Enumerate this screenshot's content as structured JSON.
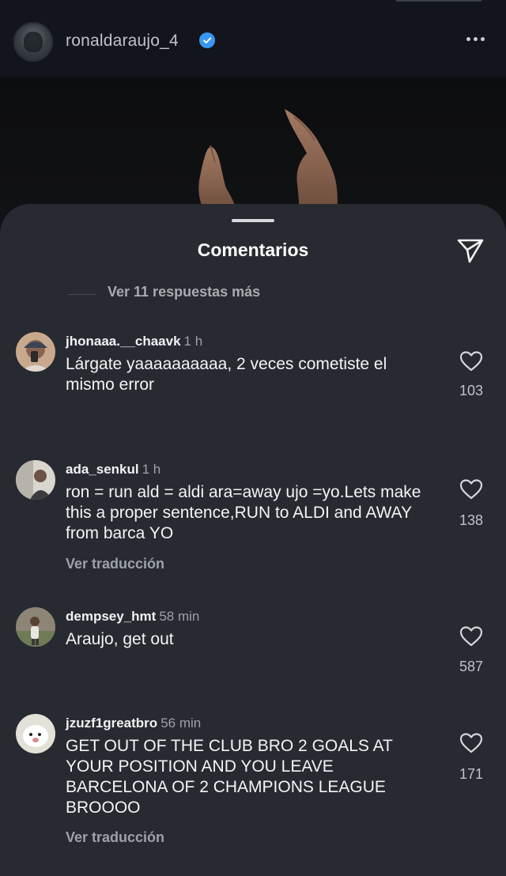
{
  "post": {
    "username": "ronaldaraujo_4"
  },
  "sheet": {
    "title": "Comentarios",
    "view_replies": "Ver 11 respuestas más"
  },
  "comments": [
    {
      "user": "jhonaaa.__chaavk",
      "time": "1 h",
      "text": "Lárgate yaaaaaaaaaa, 2 veces cometiste el mismo error",
      "likes": "103",
      "translate": ""
    },
    {
      "user": "ada_senkul",
      "time": "1 h",
      "text": "ron = run ald = aldi ara=away ujo =yo.Lets make this a proper sentence,RUN to ALDI and AWAY from barca YO",
      "likes": "138",
      "translate": "Ver traducción"
    },
    {
      "user": "dempsey_hmt",
      "time": "58 min",
      "text": "Araujo, get out",
      "likes": "587",
      "translate": ""
    },
    {
      "user": "jzuzf1greatbro",
      "time": "56 min",
      "text": "GET OUT OF THE CLUB BRO 2 GOALS AT YOUR POSITION AND YOU LEAVE BARCELONA OF 2 CHAMPIONS LEAGUE BROOOO",
      "likes": "171",
      "translate": "Ver traducción"
    }
  ],
  "colors": {
    "sheet_bg": "#272a30",
    "verified": "#3897f0",
    "muted_text": "#9ea2a8"
  },
  "icons": [
    "verified-icon",
    "more-icon",
    "share-icon",
    "heart-icon"
  ]
}
